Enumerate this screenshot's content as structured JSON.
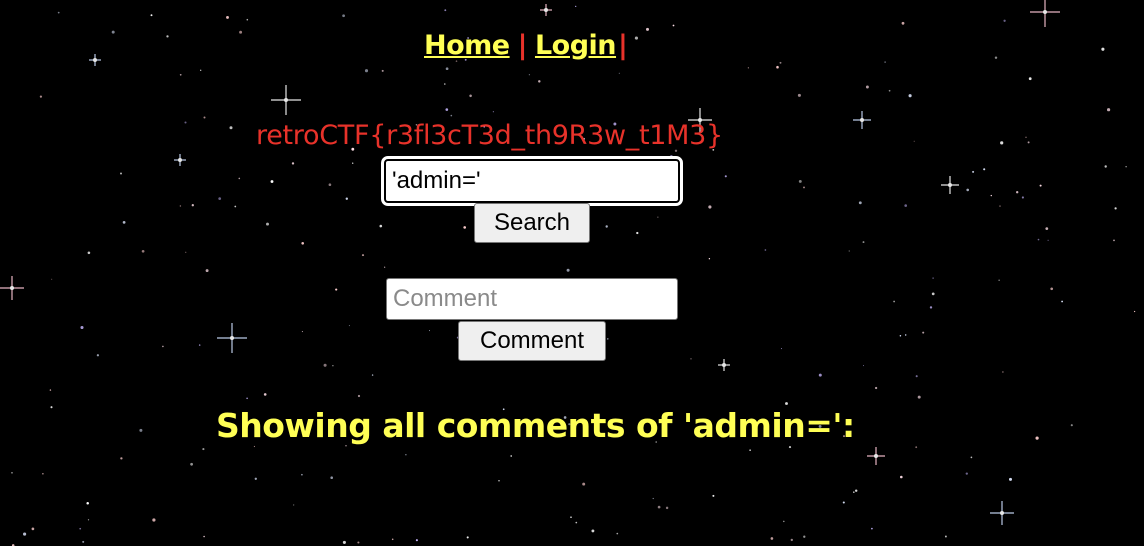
{
  "nav": {
    "home_label": "Home",
    "separator": "|",
    "login_label": "Login",
    "trailing_bar": "|"
  },
  "flag_text": "retroCTF{r3fl3cT3d_th9R3w_t1M3}",
  "search": {
    "value": "'admin='",
    "button_label": "Search"
  },
  "comment": {
    "placeholder": "Comment",
    "button_label": "Comment"
  },
  "result_heading": "Showing all comments of 'admin=':",
  "colors": {
    "background": "#000000",
    "link_yellow": "#ffff55",
    "accent_red": "#e8322a"
  },
  "background_icon": "starfield-background"
}
